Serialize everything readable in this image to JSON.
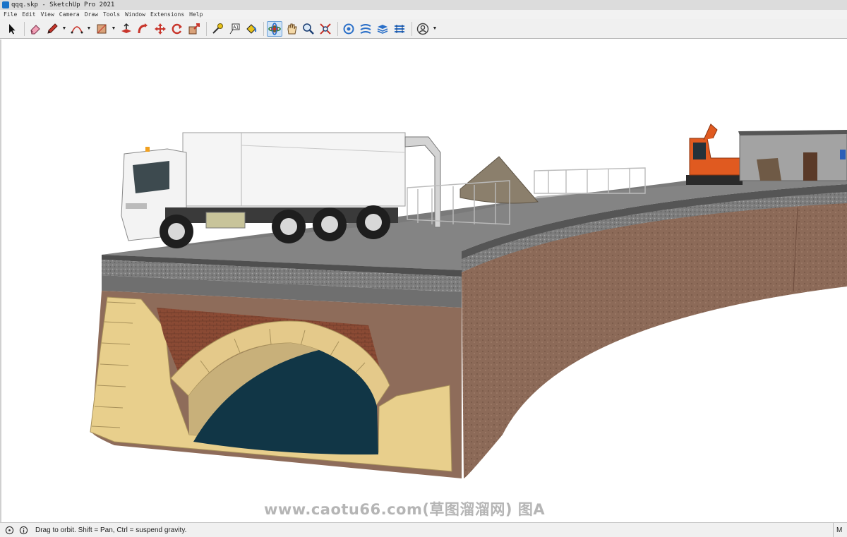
{
  "window": {
    "title": "qqq.skp - SketchUp Pro 2021"
  },
  "menu": [
    "File",
    "Edit",
    "View",
    "Camera",
    "Draw",
    "Tools",
    "Window",
    "Extensions",
    "Help"
  ],
  "toolbar": {
    "tools": [
      "select",
      "eraser",
      "pencil-line",
      "arc",
      "rectangle",
      "push-pull",
      "follow-me",
      "move",
      "rotate",
      "scale",
      "tape-measure",
      "text",
      "paint-bucket",
      "orbit",
      "pan",
      "zoom",
      "zoom-extents",
      "outliner",
      "styles",
      "layers",
      "scenes",
      "account"
    ],
    "active_tool": "orbit"
  },
  "status": {
    "message": "Drag to orbit. Shift = Pan, Ctrl = suspend gravity.",
    "measurements_label": "M"
  },
  "watermark": "www.caotu66.com(草图溜溜网) 图A",
  "colors": {
    "accent": "#1a73c8",
    "toolbar_bg": "#f0f0f0",
    "viewport_bg": "#ffffff"
  }
}
